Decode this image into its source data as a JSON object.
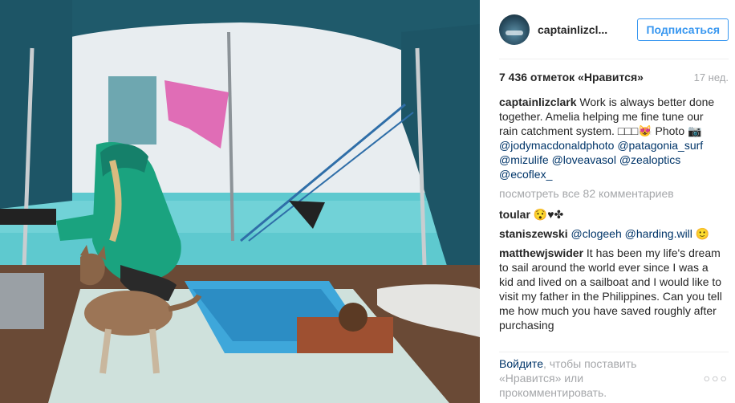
{
  "header": {
    "username": "captainlizcl...",
    "follow_label": "Подписаться"
  },
  "meta": {
    "likes": "7 436 отметок «Нравится»",
    "age": "17 нед."
  },
  "caption": {
    "user": "captainlizclark",
    "text": "Work is always better done together. Amelia helping me fine tune our rain catchment system. □□□😻 Photo 📷",
    "mentions": [
      "@jodymacdonaldphoto",
      "@patagonia_surf",
      "@mizulife",
      "@loveavasol",
      "@zealoptics",
      "@ecoflex_"
    ]
  },
  "more_comments": "посмотреть все 82 комментариев",
  "comments": [
    {
      "user": "toular",
      "text": "😯♥✤"
    },
    {
      "user": "staniszewski",
      "text": "",
      "mentions": [
        "@clogeeh",
        "@harding.will"
      ],
      "suffix": "🙂"
    },
    {
      "user": "matthewjswider",
      "text": "It has been my life's dream to sail around the world ever since I was a kid and lived on a sailboat and I would like to visit my father in the Philippines. Can you tell me how much you have saved roughly after purchasing"
    }
  ],
  "footer": {
    "login_link": "Войдите",
    "login_rest": ", чтобы поставить «Нравится» или прокомментировать.",
    "more_icon": "ellipsis-icon"
  },
  "colors": {
    "accent": "#3897f0",
    "link": "#003569",
    "muted": "#a5a7aa"
  }
}
